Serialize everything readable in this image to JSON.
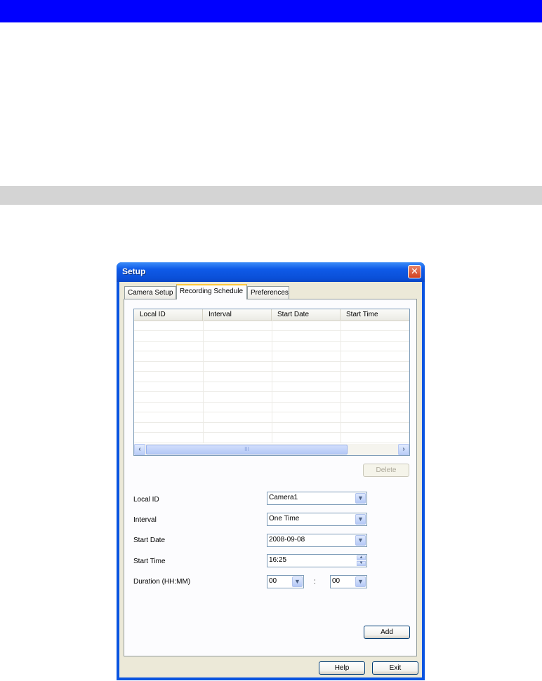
{
  "dialog": {
    "title": "Setup",
    "tabs": [
      "Camera Setup",
      "Recording Schedule",
      "Preferences"
    ],
    "active_tab": "Recording Schedule"
  },
  "table": {
    "columns": [
      "Local ID",
      "Interval",
      "Start Date",
      "Start Time"
    ],
    "rows": []
  },
  "buttons": {
    "delete": "Delete",
    "add": "Add",
    "help": "Help",
    "exit": "Exit"
  },
  "form": {
    "local_id": {
      "label": "Local ID",
      "value": "Camera1"
    },
    "interval": {
      "label": "Interval",
      "value": "One Time"
    },
    "start_date": {
      "label": "Start Date",
      "value": "2008-09-08"
    },
    "start_time": {
      "label": "Start Time",
      "value": "16:25"
    },
    "duration": {
      "label": "Duration (HH:MM)",
      "hours": "00",
      "separator": ":",
      "minutes": "00"
    }
  },
  "scroll": {
    "thumb_glyph": "III"
  }
}
